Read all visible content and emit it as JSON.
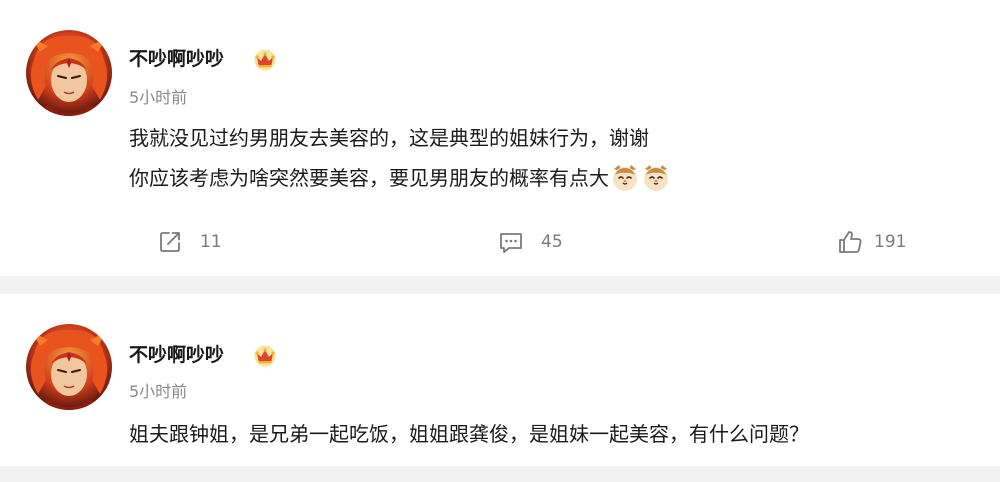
{
  "posts": [
    {
      "username": "不吵啊吵吵",
      "badge_icon": "crown-badge-icon",
      "timestamp": "5小时前",
      "content_lines": [
        "我就没见过约男朋友去美容的，这是典型的姐妹行为，谢谢",
        "你应该考虑为啥突然要美容，要见男朋友的概率有点大"
      ],
      "emojis": [
        "cat-emoji",
        "cat-emoji"
      ],
      "actions": {
        "share_count": "11",
        "comment_count": "45",
        "like_count": "191"
      }
    },
    {
      "username": "不吵啊吵吵",
      "badge_icon": "crown-badge-icon",
      "timestamp": "5小时前",
      "content_lines": [
        "姐夫跟钟姐，是兄弟一起吃饭，姐姐跟龚俊，是姐妹一起美容，有什么问题？"
      ]
    }
  ],
  "colors": {
    "text_primary": "#1a1a1a",
    "text_secondary": "#8a8a8a",
    "action_text": "#7a7a7a",
    "separator": "#f2f2f2",
    "badge_gold": "#f0b429",
    "badge_red": "#e0452b"
  }
}
